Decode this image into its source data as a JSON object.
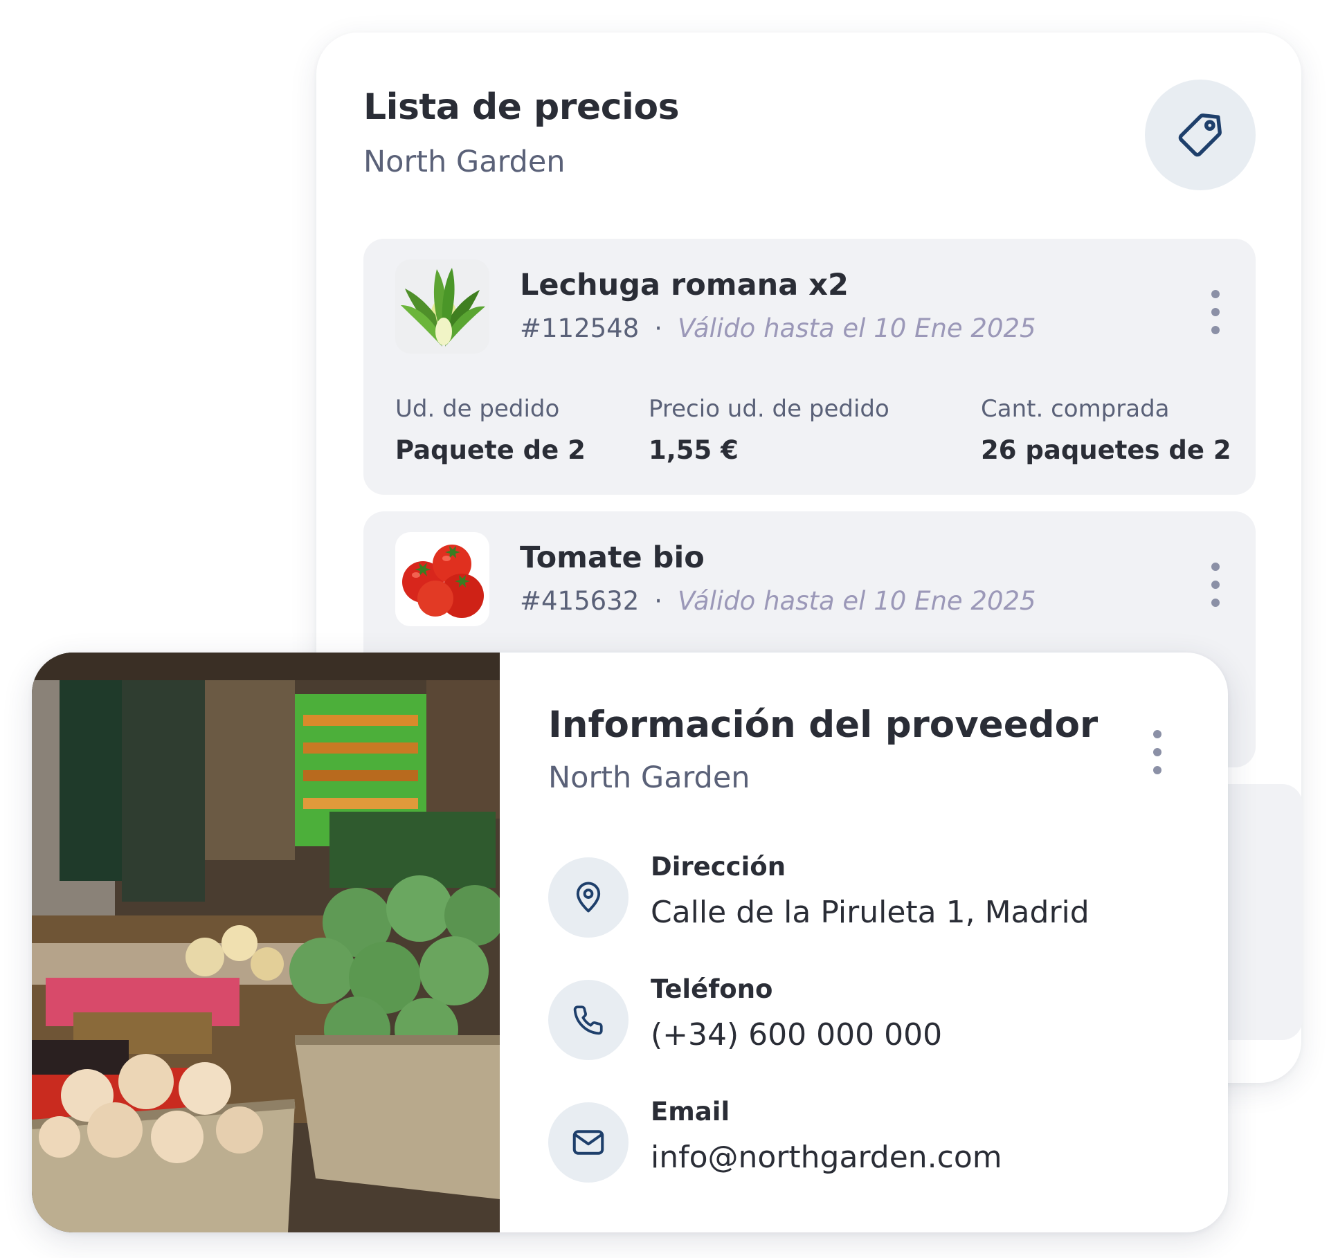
{
  "price_list": {
    "title": "Lista de precios",
    "supplier": "North Garden",
    "tag_icon": "tag-icon",
    "items": [
      {
        "name": "Lechuga romana x2",
        "code": "#112548",
        "separator": "·",
        "validity": "Válido hasta el 10 Ene 2025",
        "image": "romaine-lettuce",
        "fields": [
          {
            "label": "Ud. de pedido",
            "value": "Paquete de 2"
          },
          {
            "label": "Precio ud. de pedido",
            "value": "1,55 €"
          },
          {
            "label": "Cant. comprada",
            "value": "26 paquetes de 2"
          }
        ]
      },
      {
        "name": "Tomate bio",
        "code": "#415632",
        "separator": "·",
        "validity": "Válido hasta el 10 Ene 2025",
        "image": "tomatoes"
      }
    ]
  },
  "supplier_info": {
    "title": "Información del proveedor",
    "supplier": "North Garden",
    "photo": "market-stall-photo",
    "contacts": [
      {
        "label": "Dirección",
        "value": "Calle de la Piruleta 1, Madrid",
        "icon": "location-pin-icon"
      },
      {
        "label": "Teléfono",
        "value": "(+34) 600 000 000",
        "icon": "phone-icon"
      },
      {
        "label": "Email",
        "value": "info@northgarden.com",
        "icon": "mail-icon"
      }
    ]
  },
  "colors": {
    "text": "#2a2d36",
    "muted": "#5a6178",
    "validity": "#9b98b8",
    "icon_stroke": "#1e3f6b",
    "icon_bg": "#e8edf2",
    "row_bg": "#f1f2f5"
  }
}
